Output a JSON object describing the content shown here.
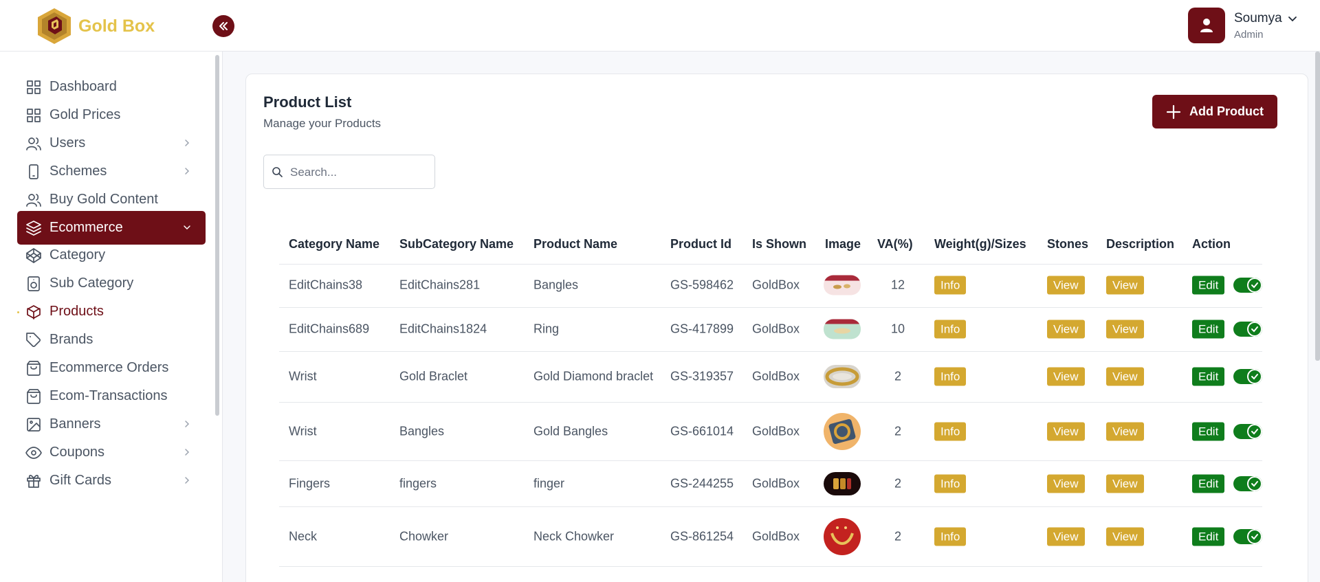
{
  "brand": {
    "name": "Gold Box"
  },
  "user": {
    "name": "Soumya",
    "role": "Admin"
  },
  "sidebar": {
    "items": [
      {
        "label": "Dashboard",
        "icon": "grid-icon",
        "has_chevron": false,
        "state": ""
      },
      {
        "label": "Gold Prices",
        "icon": "grid-icon",
        "has_chevron": false,
        "state": ""
      },
      {
        "label": "Users",
        "icon": "users-icon",
        "has_chevron": true,
        "state": ""
      },
      {
        "label": "Schemes",
        "icon": "phone-icon",
        "has_chevron": true,
        "state": ""
      },
      {
        "label": "Buy Gold Content",
        "icon": "users-icon",
        "has_chevron": false,
        "state": ""
      },
      {
        "label": "Ecommerce",
        "icon": "layers-icon",
        "has_chevron": true,
        "state": "active"
      },
      {
        "label": "Category",
        "icon": "codepen-icon",
        "has_chevron": false,
        "state": ""
      },
      {
        "label": "Sub Category",
        "icon": "speaker-icon",
        "has_chevron": false,
        "state": ""
      },
      {
        "label": "Products",
        "icon": "box-icon",
        "has_chevron": false,
        "state": "current"
      },
      {
        "label": "Brands",
        "icon": "tag-icon",
        "has_chevron": false,
        "state": ""
      },
      {
        "label": "Ecommerce Orders",
        "icon": "shopping-bag-icon",
        "has_chevron": false,
        "state": ""
      },
      {
        "label": "Ecom-Transactions",
        "icon": "shopping-bag-icon",
        "has_chevron": false,
        "state": ""
      },
      {
        "label": "Banners",
        "icon": "image-icon",
        "has_chevron": true,
        "state": ""
      },
      {
        "label": "Coupons",
        "icon": "eye-icon",
        "has_chevron": true,
        "state": ""
      },
      {
        "label": "Gift Cards",
        "icon": "gift-icon",
        "has_chevron": true,
        "state": ""
      }
    ]
  },
  "main": {
    "title": "Product List",
    "subtitle": "Manage your Products",
    "add_button_label": "Add Product",
    "search_placeholder": "Search..."
  },
  "table": {
    "columns": [
      "Category Name",
      "SubCategory Name",
      "Product Name",
      "Product Id",
      "Is Shown",
      "Image",
      "VA(%)",
      "Weight(g)/Sizes",
      "Stones",
      "Description",
      "Action"
    ],
    "info_label": "Info",
    "view_label": "View",
    "edit_label": "Edit",
    "rows": [
      {
        "category": "EditChains38",
        "subcategory": "EditChains281",
        "product": "Bangles",
        "id": "GS-598462",
        "shown": "GoldBox",
        "va": "12",
        "image": "bangles-image",
        "enabled": true
      },
      {
        "category": "EditChains689",
        "subcategory": "EditChains1824",
        "product": "Ring",
        "id": "GS-417899",
        "shown": "GoldBox",
        "va": "10",
        "image": "ring-image",
        "enabled": true
      },
      {
        "category": "Wrist",
        "subcategory": "Gold Braclet",
        "product": "Gold Diamond braclet",
        "id": "GS-319357",
        "shown": "GoldBox",
        "va": "2",
        "image": "bracelet-image",
        "enabled": true
      },
      {
        "category": "Wrist",
        "subcategory": "Bangles",
        "product": "Gold Bangles",
        "id": "GS-661014",
        "shown": "GoldBox",
        "va": "2",
        "image": "gold-bangles-image",
        "enabled": true
      },
      {
        "category": "Fingers",
        "subcategory": "fingers",
        "product": "finger",
        "id": "GS-244255",
        "shown": "GoldBox",
        "va": "2",
        "image": "finger-ring-image",
        "enabled": true
      },
      {
        "category": "Neck",
        "subcategory": "Chowker",
        "product": "Neck Chowker",
        "id": "GS-861254",
        "shown": "GoldBox",
        "va": "2",
        "image": "choker-image",
        "enabled": true
      }
    ]
  },
  "colors": {
    "primary": "#6e0f17",
    "gold": "#d4a830",
    "success": "#0f7d1c",
    "brand_text": "#e4c34a"
  }
}
